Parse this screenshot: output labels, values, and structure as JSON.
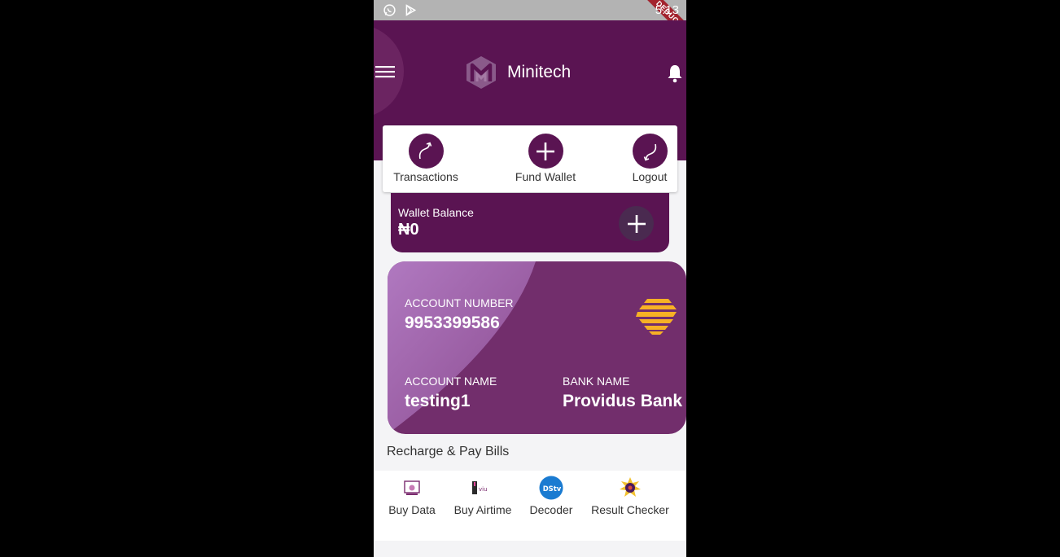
{
  "status_bar": {
    "time": "5:13",
    "debug_label": "DEBUG"
  },
  "header": {
    "brand": "Minitech"
  },
  "actions": [
    {
      "label": "Transactions"
    },
    {
      "label": "Fund Wallet"
    },
    {
      "label": "Logout"
    }
  ],
  "wallet": {
    "label": "Wallet Balance",
    "balance": "₦0"
  },
  "account": {
    "number_label": "ACCOUNT NUMBER",
    "number": "9953399586",
    "name_label": "ACCOUNT NAME",
    "name": "testing1",
    "bank_label": "BANK NAME",
    "bank": "Providus Bank"
  },
  "services_title": "Recharge & Pay Bills",
  "services": [
    {
      "label": "Buy Data",
      "icon": "data-icon"
    },
    {
      "label": "Buy Airtime",
      "icon": "airtime-icon"
    },
    {
      "label": "Decoder",
      "icon": "dstv-icon"
    },
    {
      "label": "Result Checker",
      "icon": "waec-icon"
    }
  ],
  "colors": {
    "primary": "#5a1452",
    "card": "#722e6c",
    "bank_logo": "#f7b125"
  }
}
